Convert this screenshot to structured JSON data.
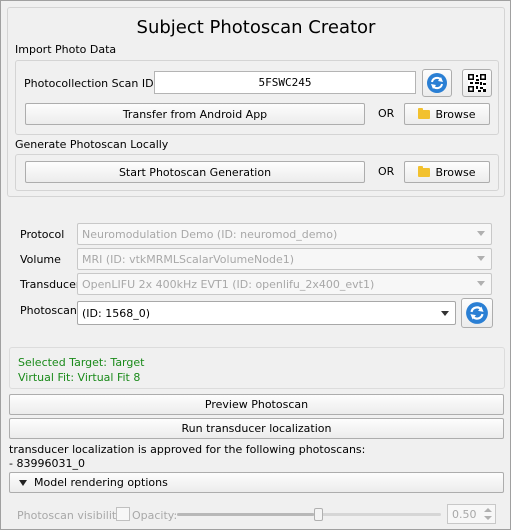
{
  "title": "Subject Photoscan Creator",
  "import": {
    "group_label": "Import Photo Data",
    "scan_id_label": "Photocollection Scan ID:",
    "scan_id_value": "5FSWC245",
    "transfer_button": "Transfer from Android App",
    "or_label": "OR",
    "browse_button": "Browse"
  },
  "generate": {
    "group_label": "Generate Photoscan Locally",
    "start_button": "Start Photoscan Generation",
    "or_label": "OR",
    "browse_button": "Browse"
  },
  "form": {
    "protocol_label": "Protocol",
    "protocol_value": "Neuromodulation Demo (ID: neuromod_demo)",
    "volume_label": "Volume",
    "volume_value": "MRI (ID: vtkMRMLScalarVolumeNode1)",
    "transducer_label": "Transducer",
    "transducer_value": "OpenLIFU 2x 400kHz EVT1 (ID: openlifu_2x400_evt1)",
    "photoscan_label": "Photoscan",
    "photoscan_value": "(ID: 1568_0)"
  },
  "status": {
    "selected_target": "Selected Target: Target",
    "virtual_fit": "Virtual Fit: Virtual Fit 8"
  },
  "actions": {
    "preview_button": "Preview Photoscan",
    "run_button": "Run transducer localization"
  },
  "approval": {
    "line1": "transducer localization is approved for the following photoscans:",
    "line2": "- 83996031_0"
  },
  "rendering": {
    "collapsible_label": "Model rendering options",
    "visibility_label": "Photoscan visibility:",
    "opacity_label": "Opacity:",
    "opacity_value": "0.50",
    "opacity_fraction": 0.5
  }
}
